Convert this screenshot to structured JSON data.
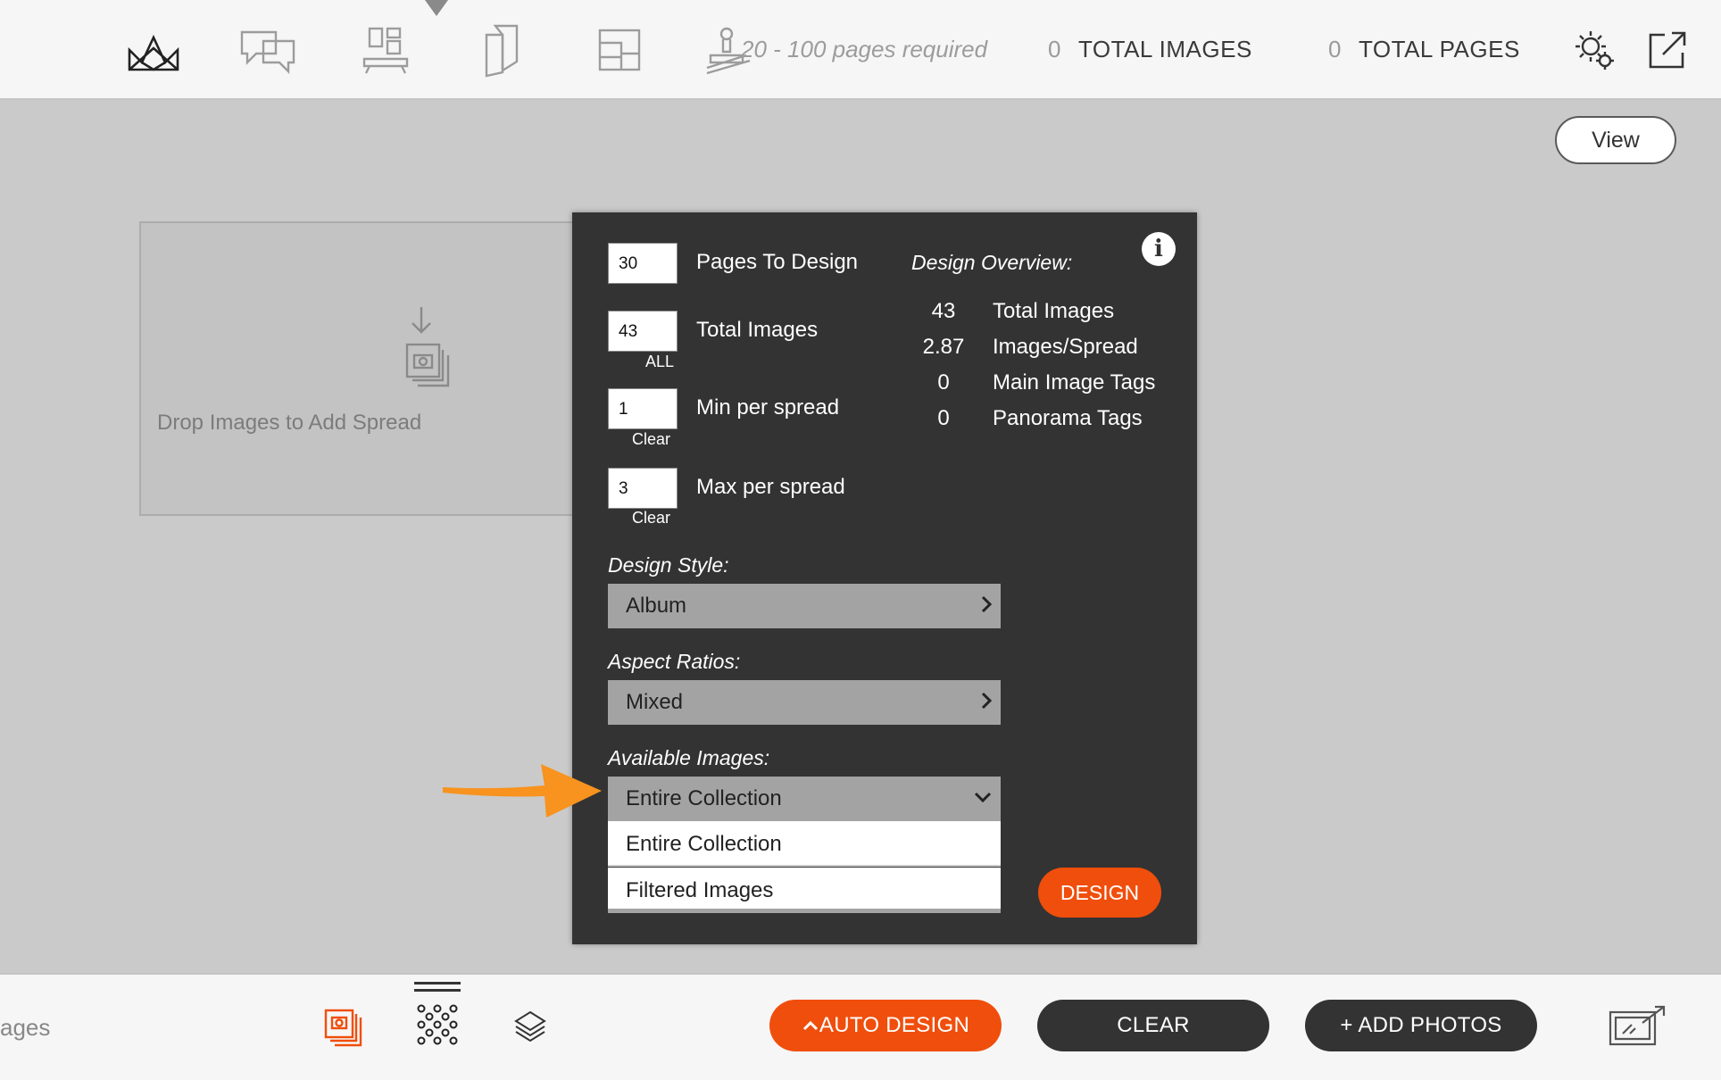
{
  "header": {
    "pages_required": "20 - 100 pages required",
    "total_images_count": "0",
    "total_images_label": "TOTAL IMAGES",
    "total_pages_count": "0",
    "total_pages_label": "TOTAL PAGES",
    "icons": [
      "album-icon",
      "proof-comments-icon",
      "layout-icon",
      "pages-icon",
      "template-icon",
      "stamp-icon",
      "settings-gear-icon",
      "export-icon"
    ]
  },
  "view_button": "View",
  "drop_zone": {
    "text": "Drop Images to Add Spread"
  },
  "auto_design_panel": {
    "fields": {
      "pages_to_design": {
        "value": "30",
        "label": "Pages To Design"
      },
      "total_images": {
        "value": "43",
        "label": "Total Images",
        "sub": "ALL"
      },
      "min_per_spread": {
        "value": "1",
        "label": "Min per spread",
        "sub": "Clear"
      },
      "max_per_spread": {
        "value": "3",
        "label": "Max per spread",
        "sub": "Clear"
      }
    },
    "overview": {
      "title": "Design Overview:",
      "rows": [
        {
          "value": "43",
          "label": "Total Images"
        },
        {
          "value": "2.87",
          "label": "Images/Spread"
        },
        {
          "value": "0",
          "label": "Main Image Tags"
        },
        {
          "value": "0",
          "label": "Panorama Tags"
        }
      ]
    },
    "design_style": {
      "title": "Design Style:",
      "value": "Album"
    },
    "aspect_ratios": {
      "title": "Aspect Ratios:",
      "value": "Mixed"
    },
    "available_images": {
      "title": "Available Images:",
      "value": "Entire Collection",
      "options": [
        "Entire Collection",
        "Filtered Images"
      ]
    },
    "design_button": "DESIGN"
  },
  "footer": {
    "partial_label": "ages",
    "auto_design": "AUTO DESIGN",
    "clear": "CLEAR",
    "add_photos": "+ ADD PHOTOS"
  },
  "colors": {
    "accent": "#f04e0c",
    "panel": "#333333",
    "arrow": "#f7931e",
    "dark_button": "#333333"
  }
}
